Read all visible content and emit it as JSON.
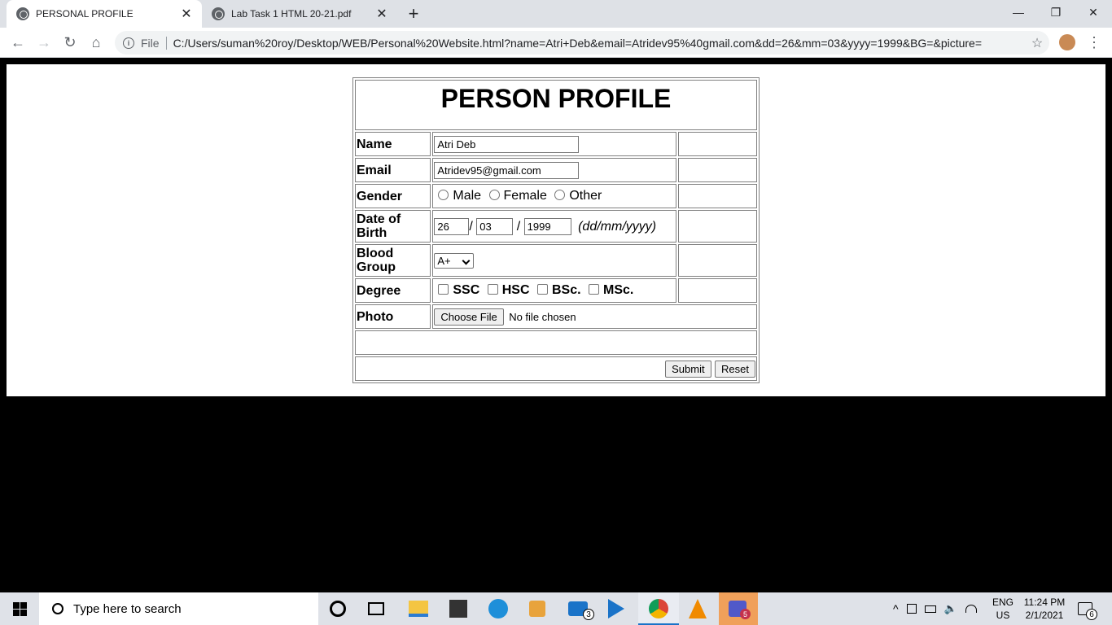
{
  "browser": {
    "tabs": [
      {
        "title": "PERSONAL PROFILE",
        "active": true
      },
      {
        "title": "Lab Task 1 HTML 20-21.pdf",
        "active": false
      }
    ],
    "new_tab": "+",
    "window_controls": {
      "minimize": "—",
      "restore": "❐",
      "close": "✕"
    },
    "nav": {
      "back": "←",
      "forward": "→",
      "reload": "↻",
      "home": "⌂"
    },
    "address": {
      "scheme": "File",
      "url": "C:/Users/suman%20roy/Desktop/WEB/Personal%20Website.html?name=Atri+Deb&email=Atridev95%40gmail.com&dd=26&mm=03&yyyy=1999&BG=&picture="
    },
    "bookmark": "☆",
    "menu": "⋮"
  },
  "form": {
    "title": "PERSON PROFILE",
    "name_label": "Name",
    "name_value": "Atri Deb",
    "email_label": "Email",
    "email_value": "Atridev95@gmail.com",
    "gender_label": "Gender",
    "gender_options": [
      "Male",
      "Female",
      "Other"
    ],
    "dob_label": "Date of Birth",
    "dob_day": "26",
    "dob_month": "03",
    "dob_year": "1999",
    "dob_sep": "/",
    "dob_hint": "(dd/mm/yyyy)",
    "blood_label": "Blood Group",
    "blood_value": "A+",
    "degree_label": "Degree",
    "degree_options": [
      "SSC",
      "HSC",
      "BSc.",
      "MSc."
    ],
    "photo_label": "Photo",
    "choose_file": "Choose File",
    "no_file": "No file chosen",
    "submit": "Submit",
    "reset": "Reset"
  },
  "taskbar": {
    "search_placeholder": "Type here to search",
    "mail_badge": "3",
    "teams_badge": "5",
    "lang": "ENG",
    "region": "US",
    "time": "11:24 PM",
    "date": "2/1/2021",
    "notification_count": "6"
  }
}
